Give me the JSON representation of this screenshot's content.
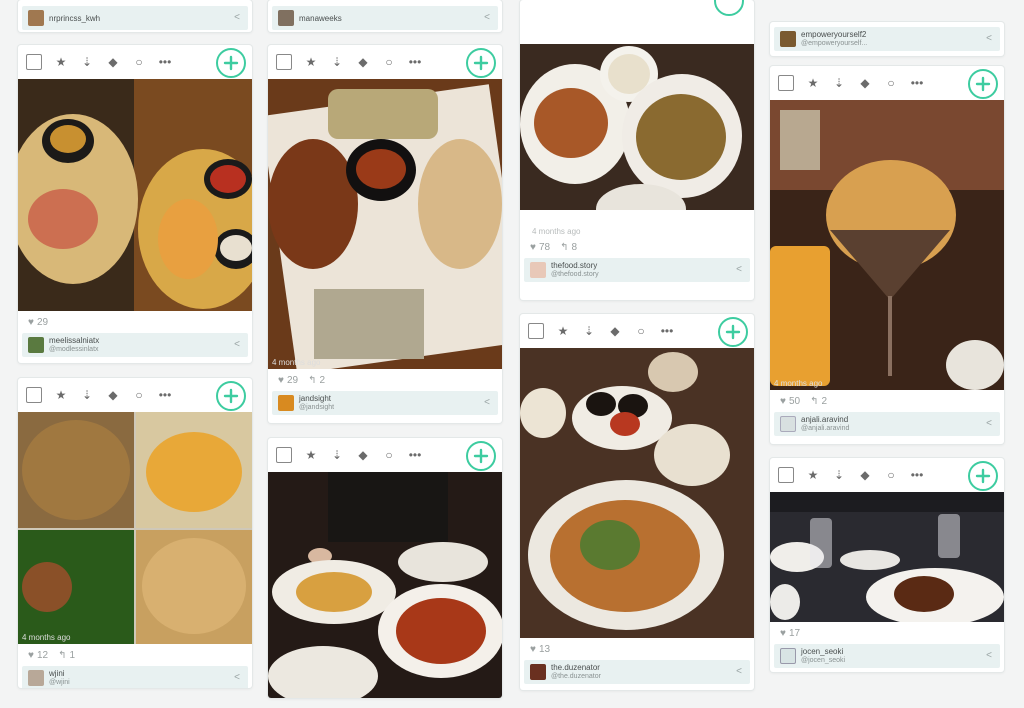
{
  "toolbar": {
    "icons": [
      "checkbox",
      "star-icon",
      "pin-icon",
      "tag-icon",
      "circle-icon",
      "more-icon",
      "add-icon"
    ]
  },
  "colors": {
    "accent": "#3dcca0",
    "user_bar": "#e8f1f1",
    "bg": "#f3f4f4"
  },
  "cards": {
    "c1_top": {
      "name": "nrprincss_kwh",
      "handle": ""
    },
    "c1a": {
      "likes": "29",
      "name": "meelissalniatx",
      "handle": "@modlessinlatx"
    },
    "c1b": {
      "time": "4 months ago",
      "likes": "12",
      "reposts": "1",
      "name": "wjini",
      "handle": "@wjini"
    },
    "c2_top": {
      "name": "manaweeks",
      "handle": ""
    },
    "c2a": {
      "time": "4 months ago",
      "likes": "29",
      "reposts": "2",
      "name": "jandsight",
      "handle": "@jandsight"
    },
    "c2b": {},
    "c3a": {
      "time": "4 months ago",
      "likes": "78",
      "reposts": "8",
      "name": "thefood.story",
      "handle": "@thefood.story"
    },
    "c3b": {
      "likes": "13",
      "name": "the.duzenator",
      "handle": "@the.duzenator"
    },
    "c4_top": {
      "name": "empoweryourself2",
      "handle": "@empoweryourself..."
    },
    "c4a": {
      "time": "4 months ago",
      "likes": "50",
      "reposts": "2",
      "name": "anjali.aravind",
      "handle": "@anjali.aravind"
    },
    "c4b": {
      "likes": "17",
      "name": "jocen_seoki",
      "handle": "@jocen_seoki"
    }
  }
}
